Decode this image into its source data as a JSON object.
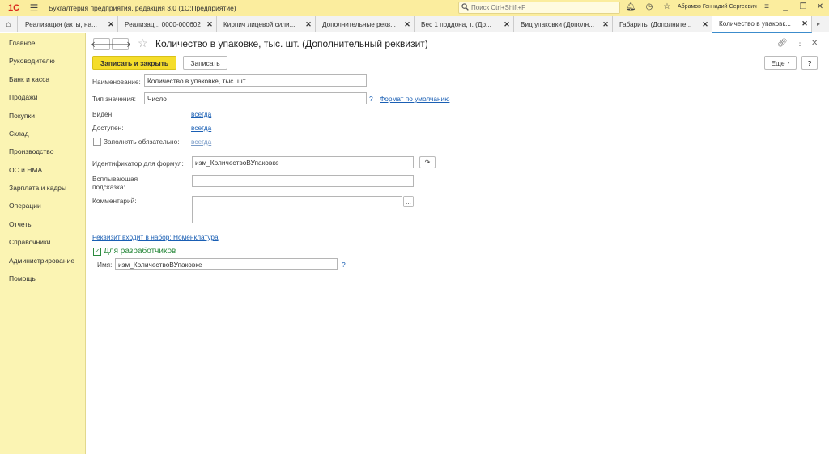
{
  "titlebar": {
    "logo": "1С",
    "app_title": "Бухгалтерия предприятия, редакция 3.0  (1С:Предприятие)",
    "search_placeholder": "Поиск Ctrl+Shift+F",
    "user_name": "Абрамов Геннадий Сергеевич"
  },
  "tabs": [
    {
      "label": "Реализация (акты, на..."
    },
    {
      "label": "Реализац... 0000-000602"
    },
    {
      "label": "Кирпич лицевой сили..."
    },
    {
      "label": "Дополнительные рекв..."
    },
    {
      "label": "Вес 1 поддона, т. (До..."
    },
    {
      "label": "Вид упаковки (Дополн..."
    },
    {
      "label": "Габариты (Дополните..."
    },
    {
      "label": "Количество в упаковк..."
    }
  ],
  "sidebar": {
    "items": [
      {
        "label": "Главное"
      },
      {
        "label": "Руководителю"
      },
      {
        "label": "Банк и касса"
      },
      {
        "label": "Продажи"
      },
      {
        "label": "Покупки"
      },
      {
        "label": "Склад"
      },
      {
        "label": "Производство"
      },
      {
        "label": "ОС и НМА"
      },
      {
        "label": "Зарплата и кадры"
      },
      {
        "label": "Операции"
      },
      {
        "label": "Отчеты"
      },
      {
        "label": "Справочники"
      },
      {
        "label": "Администрирование"
      },
      {
        "label": "Помощь"
      }
    ]
  },
  "form": {
    "title": "Количество в упаковке, тыс. шт. (Дополнительный реквизит)",
    "save_close_label": "Записать и закрыть",
    "save_label": "Записать",
    "more_label": "Еще",
    "help_label": "?",
    "name_label": "Наименование:",
    "name_value": "Количество в упаковке, тыс. шт.",
    "type_label": "Тип значения:",
    "type_value": "Число",
    "format_link": "Формат по умолчанию",
    "visible_label": "Виден:",
    "visible_value": "всегда",
    "available_label": "Доступен:",
    "available_value": "всегда",
    "required_label": "Заполнять обязательно:",
    "required_value": "всегда",
    "formula_id_label": "Идентификатор для формул:",
    "formula_id_value": "изм_КоличествоВУпаковке",
    "tooltip_label": "Всплывающая подсказка:",
    "tooltip_value": "",
    "comment_label": "Комментарий:",
    "comment_value": "",
    "comment_btn": "...",
    "set_link": "Реквизит входит в набор: Номенклатура",
    "dev_group_title": "Для разработчиков",
    "dev_name_label": "Имя:",
    "dev_name_value": "изм_КоличествоВУпаковке",
    "help_q": "?"
  }
}
